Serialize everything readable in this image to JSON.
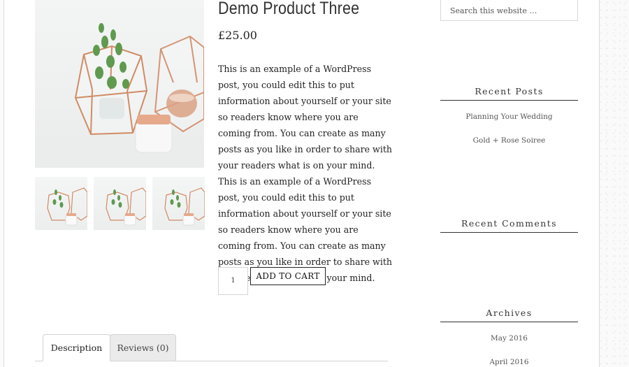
{
  "product": {
    "title": "Demo Product Three",
    "price": "£25.00",
    "description": "This is an example of a WordPress post, you could edit this to put information about yourself or your site so readers know where you are coming from. You can create as many posts as you like in order to share with your readers what is on your mind. This is an example of a WordPress post, you could edit this to put information about yourself or your site so readers know where you are coming from. You can create as many posts as you like in order to share with your readers what is on your mind.",
    "quantity": "1",
    "add_to_cart_label": "ADD TO CART"
  },
  "tabs": [
    {
      "label": "Description",
      "active": true
    },
    {
      "label": "Reviews (0)",
      "active": false
    }
  ],
  "sidebar": {
    "search_placeholder": "Search this website …",
    "recent_posts": {
      "title": "Recent Posts",
      "items": [
        "Planning Your Wedding",
        "Gold + Rose Soiree"
      ]
    },
    "recent_comments": {
      "title": "Recent Comments"
    },
    "archives": {
      "title": "Archives",
      "items": [
        "May 2016",
        "April 2016"
      ]
    }
  },
  "colors": {
    "copper": "#d9906d",
    "leaf": "#5f9a4f",
    "accent_dark": "#222222"
  }
}
